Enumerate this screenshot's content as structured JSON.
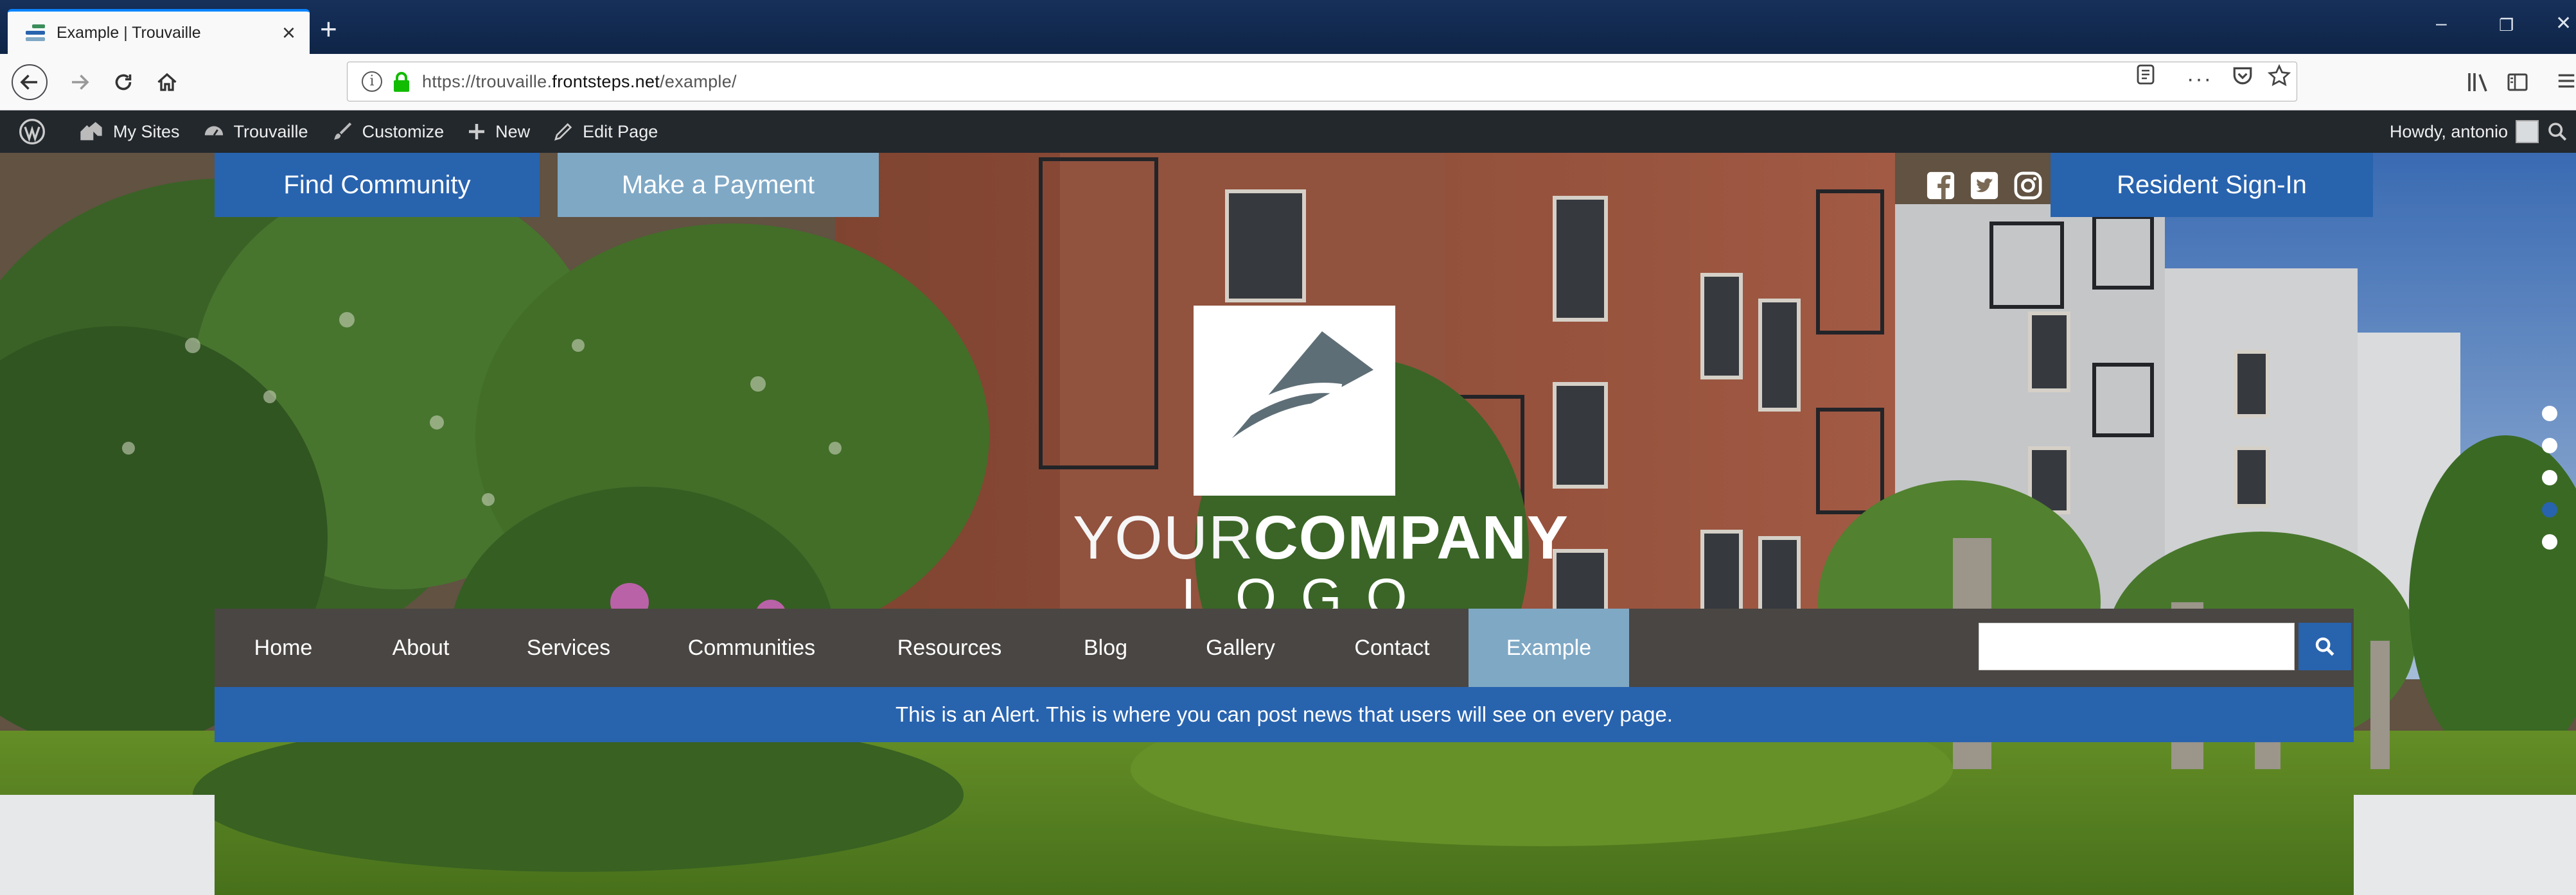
{
  "browser": {
    "tab_title": "Example | Trouvaille",
    "url_prefix": "https://trouvaille.",
    "url_domain": "frontsteps.net",
    "url_path": "/example/"
  },
  "admin_bar": {
    "items": [
      {
        "label": "My Sites",
        "icon": "my-sites-icon"
      },
      {
        "label": "Trouvaille",
        "icon": "dashboard-icon"
      },
      {
        "label": "Customize",
        "icon": "paintbrush-icon"
      },
      {
        "label": "New",
        "icon": "plus-icon"
      },
      {
        "label": "Edit Page",
        "icon": "pencil-icon"
      }
    ],
    "greeting": "Howdy, antonio"
  },
  "hero": {
    "find_community": "Find Community",
    "make_payment": "Make a Payment",
    "resident_signin": "Resident Sign-In",
    "logo_line1_thin": "YOUR",
    "logo_line1_bold": "COMPANY",
    "logo_line2": "LOGO",
    "slider_active_index": 3,
    "slider_count": 5
  },
  "nav": {
    "items": [
      "Home",
      "About",
      "Services",
      "Communities",
      "Resources",
      "Blog",
      "Gallery",
      "Contact",
      "Example"
    ],
    "active": "Example",
    "search_value": ""
  },
  "alert": {
    "text": "This is an Alert. This is where you can post news that users will see on every page."
  },
  "colors": {
    "primary_blue": "#2863ae",
    "light_blue": "#7fa8c5",
    "nav_bg": "#4a4643",
    "admin_bar_bg": "#23282d"
  }
}
